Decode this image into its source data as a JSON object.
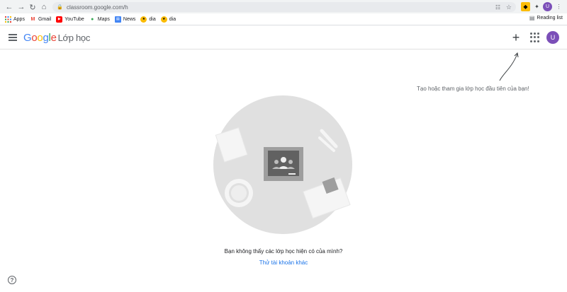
{
  "browser": {
    "url": "classroom.google.com/h",
    "profile_initial": "U",
    "bookmarks": [
      {
        "label": "Apps",
        "icon": "apps-grid-icon"
      },
      {
        "label": "Gmail",
        "icon": "gmail-icon"
      },
      {
        "label": "YouTube",
        "icon": "youtube-icon"
      },
      {
        "label": "Maps",
        "icon": "maps-pin-icon"
      },
      {
        "label": "News",
        "icon": "news-icon"
      },
      {
        "label": "dia",
        "icon": "dia-icon"
      },
      {
        "label": "dia",
        "icon": "dia-icon"
      }
    ],
    "reading_list": "Reading list"
  },
  "header": {
    "logo_letters": [
      "G",
      "o",
      "o",
      "g",
      "l",
      "e"
    ],
    "product_name": "Lớp học",
    "account_initial": "U"
  },
  "hint": {
    "text": "Tạo hoặc tham gia lớp học đầu tiên của bạn!"
  },
  "main": {
    "empty_message": "Bạn không thấy các lớp học hiện có của mình?",
    "switch_account": "Thử tài khoản khác"
  },
  "colors": {
    "google_blue": "#4285f4",
    "google_red": "#ea4335",
    "google_yellow": "#fbbc05",
    "google_green": "#34a853",
    "link_blue": "#1a73e8",
    "avatar_purple": "#7b4fb8"
  }
}
